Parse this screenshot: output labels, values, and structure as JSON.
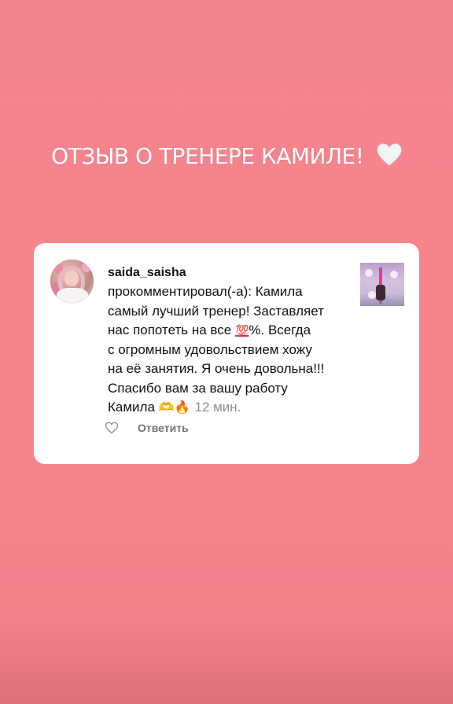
{
  "story": {
    "title": "ОТЗЫВ О ТРЕНЕРЕ КАМИЛЕ!"
  },
  "comment": {
    "username": "saida_saisha",
    "text_lines": [
      "прокомментировал(-а): Камила",
      "самый лучший тренер! Заставляет",
      "нас попотеть на все ",
      "%. Всегда",
      "с огромным удовольствием хожу",
      "на её занятия. Я очень довольна!!!",
      "Спасибо вам за вашу работу",
      "Камила "
    ],
    "emoji_100": "💯",
    "emoji_heart_hands": "🫶",
    "emoji_fire": "🔥",
    "time": "12 мин.",
    "reply_label": "Ответить"
  },
  "icons": {
    "title_heart": "white-heart-icon",
    "like": "heart-outline-icon"
  },
  "colors": {
    "background": "#f7838c",
    "card": "#ffffff",
    "muted": "#8e8e8e"
  }
}
